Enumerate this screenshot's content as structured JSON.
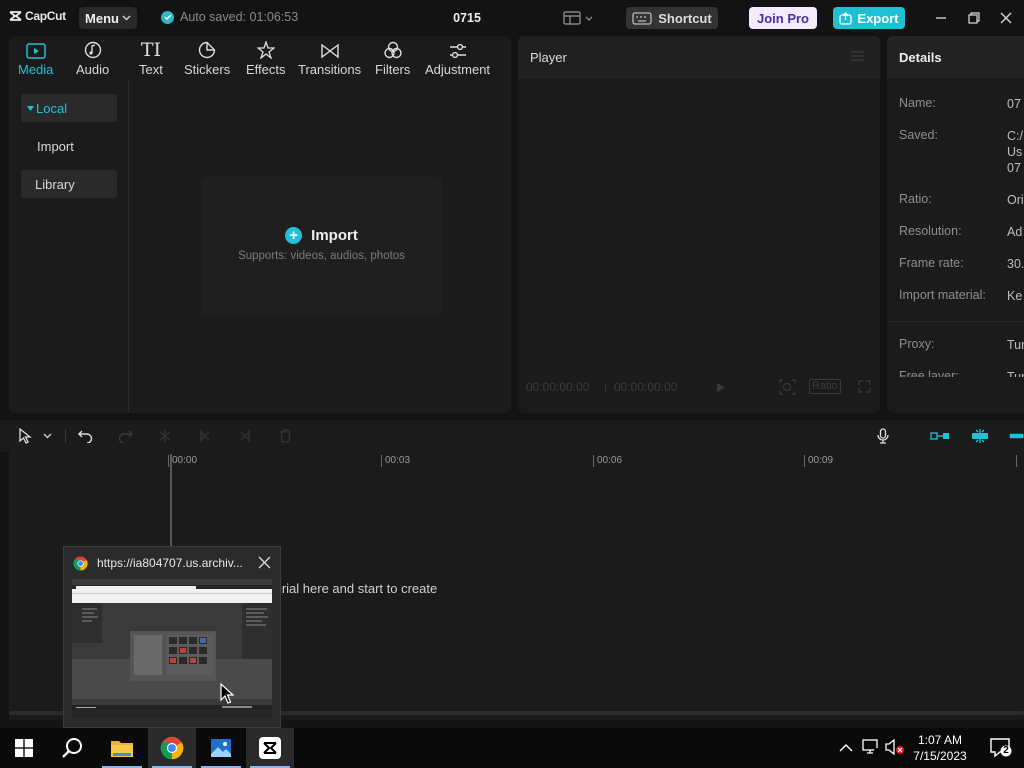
{
  "titlebar": {
    "app_name": "CapCut",
    "menu_label": "Menu",
    "autosave_text": "Auto saved: 01:06:53",
    "project_title": "0715",
    "shortcut_label": "Shortcut",
    "join_pro_label": "Join Pro",
    "export_label": "Export"
  },
  "media_tabs": [
    {
      "label": "Media",
      "icon": "media-icon",
      "active": true
    },
    {
      "label": "Audio",
      "icon": "audio-icon"
    },
    {
      "label": "Text",
      "icon": "text-icon"
    },
    {
      "label": "Stickers",
      "icon": "stickers-icon"
    },
    {
      "label": "Effects",
      "icon": "effects-icon"
    },
    {
      "label": "Transitions",
      "icon": "transitions-icon"
    },
    {
      "label": "Filters",
      "icon": "filters-icon"
    },
    {
      "label": "Adjustment",
      "icon": "adjustment-icon"
    }
  ],
  "sidebar": {
    "local": "Local",
    "import": "Import",
    "library": "Library"
  },
  "import_box": {
    "title": "Import",
    "subtitle": "Supports: videos, audios, photos"
  },
  "player": {
    "title": "Player",
    "current_time": "00:00:00:00",
    "total_time": "00:00:00:00",
    "ratio_label": "Ratio"
  },
  "details": {
    "title": "Details",
    "rows": [
      {
        "label": "Name:",
        "value": "07"
      },
      {
        "label": "Saved:",
        "value": "C:/\nUs\n07"
      },
      {
        "label": "Ratio:",
        "value": "Ori"
      },
      {
        "label": "Resolution:",
        "value": "Ad"
      },
      {
        "label": "Frame rate:",
        "value": "30."
      },
      {
        "label": "Import material:",
        "value": "Ke"
      },
      {
        "label": "Proxy:",
        "value": "Tur"
      },
      {
        "label": "Free layer:",
        "value": "Tur"
      }
    ]
  },
  "timeline": {
    "ticks": [
      "00:00",
      "00:03",
      "00:06",
      "00:09"
    ],
    "drop_hint": "terial here and start to create"
  },
  "popup": {
    "title": "https://ia804707.us.archiv..."
  },
  "taskbar": {
    "time": "1:07 AM",
    "date": "7/15/2023",
    "notification_count": "2"
  },
  "colors": {
    "accent": "#1fc3d6",
    "background": "#131313",
    "panel": "#1b1b1b"
  }
}
